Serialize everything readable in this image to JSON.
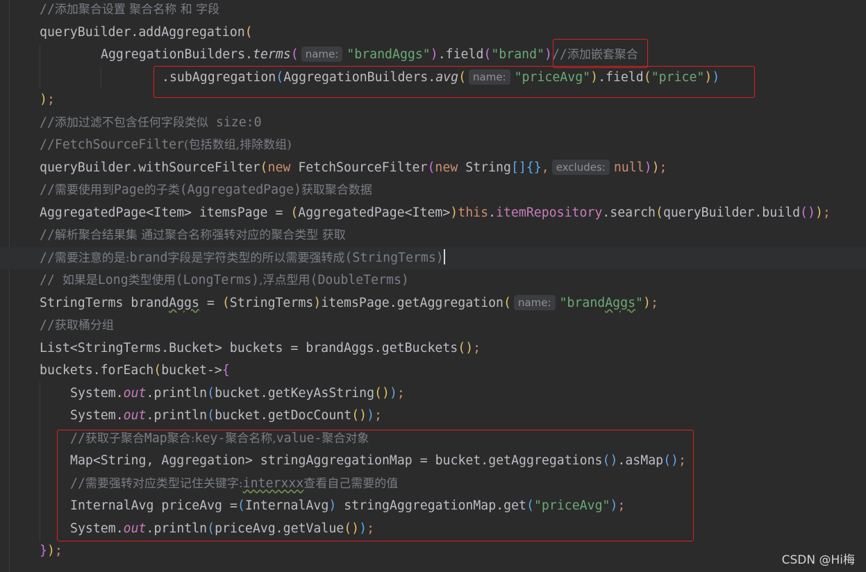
{
  "lines": [
    {
      "indent": 57,
      "segs": [
        {
          "t": "//",
          "c": "cm"
        },
        {
          "t": "添加聚合设置 聚合名称 和 字段",
          "c": "cmz"
        }
      ]
    },
    {
      "indent": 57,
      "segs": [
        {
          "t": "queryBuilder.addAggregation"
        },
        {
          "t": "(",
          "c": "p1"
        }
      ]
    },
    {
      "indent": 145,
      "segs": [
        {
          "t": "AggregationBuilders."
        },
        {
          "t": "terms",
          "c": "itm"
        },
        {
          "t": "(",
          "c": "p2"
        },
        {
          "h": "name:"
        },
        {
          "t": "\"brandAggs\"",
          "c": "str"
        },
        {
          "t": ")",
          "c": "p2"
        },
        {
          "t": ".field"
        },
        {
          "t": "(",
          "c": "p2"
        },
        {
          "t": "\"brand\"",
          "c": "str"
        },
        {
          "t": ")",
          "c": "p2"
        },
        {
          "t": "//",
          "c": "cm"
        },
        {
          "t": "添加嵌套聚合",
          "c": "cmz"
        }
      ]
    },
    {
      "indent": 233,
      "segs": [
        {
          "t": ".subAggregation"
        },
        {
          "t": "(",
          "c": "p3"
        },
        {
          "t": "AggregationBuilders."
        },
        {
          "t": "avg",
          "c": "itm"
        },
        {
          "t": "(",
          "c": "p1"
        },
        {
          "h": "name:"
        },
        {
          "t": "\"priceAvg\"",
          "c": "str"
        },
        {
          "t": ")",
          "c": "p1"
        },
        {
          "t": ".field"
        },
        {
          "t": "(",
          "c": "p1"
        },
        {
          "t": "\"price\"",
          "c": "str"
        },
        {
          "t": ")",
          "c": "p1"
        },
        {
          "t": ")",
          "c": "p3"
        }
      ]
    },
    {
      "indent": 57,
      "segs": [
        {
          "t": ")",
          "c": "p1"
        },
        {
          "t": ";",
          "c": "kw"
        }
      ]
    },
    {
      "indent": 57,
      "segs": [
        {
          "t": "//",
          "c": "cm"
        },
        {
          "t": "添加过滤不包含任何字段类似",
          "c": "cmz"
        },
        {
          "t": " size:0",
          "c": "cm"
        }
      ]
    },
    {
      "indent": 57,
      "segs": [
        {
          "t": "//FetchSourceFilter",
          "c": "cm"
        },
        {
          "t": "(包括数组,排除数组)",
          "c": "cmz"
        }
      ]
    },
    {
      "indent": 57,
      "segs": [
        {
          "t": "queryBuilder.withSourceFilter"
        },
        {
          "t": "(",
          "c": "p1"
        },
        {
          "t": "new ",
          "c": "kw"
        },
        {
          "t": "FetchSourceFilter"
        },
        {
          "t": "(",
          "c": "p2"
        },
        {
          "t": "new ",
          "c": "kw"
        },
        {
          "t": "String"
        },
        {
          "t": "[]{}",
          "c": "p3"
        },
        {
          "t": ",",
          "c": "kw"
        },
        {
          "h": "excludes:"
        },
        {
          "t": "null",
          "c": "kw"
        },
        {
          "t": ")",
          "c": "p2"
        },
        {
          "t": ")",
          "c": "p1"
        },
        {
          "t": ";",
          "c": "kw"
        }
      ]
    },
    {
      "indent": 57,
      "segs": [
        {
          "t": "//",
          "c": "cm"
        },
        {
          "t": "需要使用到",
          "c": "cmz"
        },
        {
          "t": "Page",
          "c": "cm"
        },
        {
          "t": "的子类",
          "c": "cmz"
        },
        {
          "t": "(AggregatedPage)",
          "c": "cm"
        },
        {
          "t": "获取聚合数据",
          "c": "cmz"
        }
      ]
    },
    {
      "indent": 57,
      "segs": [
        {
          "t": "AggregatedPage<Item> itemsPage = "
        },
        {
          "t": "(",
          "c": "p1"
        },
        {
          "t": "AggregatedPage<Item>"
        },
        {
          "t": ")",
          "c": "p1"
        },
        {
          "t": "this",
          "c": "kw"
        },
        {
          "t": "."
        },
        {
          "t": "itemRepository",
          "c": "fld"
        },
        {
          "t": ".search"
        },
        {
          "t": "(",
          "c": "p1"
        },
        {
          "t": "queryBuilder.build"
        },
        {
          "t": "()",
          "c": "p2"
        },
        {
          "t": ")",
          "c": "p1"
        },
        {
          "t": ";",
          "c": "kw"
        }
      ]
    },
    {
      "indent": 57,
      "segs": [
        {
          "t": "//",
          "c": "cm"
        },
        {
          "t": "解析聚合结果集 通过聚合名称强转对应的聚合类型 获取",
          "c": "cmz"
        }
      ]
    },
    {
      "indent": 57,
      "current": true,
      "segs": [
        {
          "t": "//",
          "c": "cm"
        },
        {
          "t": "需要注意的是:",
          "c": "cmz"
        },
        {
          "t": "brand",
          "c": "cm"
        },
        {
          "t": "字段是字符类型的所以需要强转成",
          "c": "cmz"
        },
        {
          "t": "(StringTerms)",
          "c": "cm"
        },
        {
          "caret": true
        }
      ]
    },
    {
      "indent": 57,
      "segs": [
        {
          "t": "// ",
          "c": "cm"
        },
        {
          "t": "如果是",
          "c": "cmz"
        },
        {
          "t": "Long",
          "c": "cm"
        },
        {
          "t": "类型使用",
          "c": "cmz"
        },
        {
          "t": "(LongTerms)",
          "c": "cm"
        },
        {
          "t": ",浮点型用",
          "c": "cmz"
        },
        {
          "t": "(DoubleTerms)",
          "c": "cm"
        }
      ]
    },
    {
      "indent": 57,
      "segs": [
        {
          "t": "StringTerms brand"
        },
        {
          "t": "Aggs",
          "c": "squig"
        },
        {
          "t": " = "
        },
        {
          "t": "(",
          "c": "p1"
        },
        {
          "t": "StringTerms"
        },
        {
          "t": ")",
          "c": "p1"
        },
        {
          "t": "itemsPage.getAggregation"
        },
        {
          "t": "(",
          "c": "p1"
        },
        {
          "h": "name:"
        },
        {
          "t": "\"brand",
          "c": "str"
        },
        {
          "t": "Aggs",
          "c": "str squig"
        },
        {
          "t": "\"",
          "c": "str"
        },
        {
          "t": ")",
          "c": "p1"
        },
        {
          "t": ";",
          "c": "kw"
        }
      ]
    },
    {
      "indent": 57,
      "segs": [
        {
          "t": "//",
          "c": "cm"
        },
        {
          "t": "获取桶分组",
          "c": "cmz"
        }
      ]
    },
    {
      "indent": 57,
      "segs": [
        {
          "t": "List<StringTerms.Bucket> buckets = brandAggs.getBuckets"
        },
        {
          "t": "()",
          "c": "p1"
        },
        {
          "t": ";",
          "c": "kw"
        }
      ]
    },
    {
      "indent": 57,
      "segs": [
        {
          "t": "buckets.forEach"
        },
        {
          "t": "(",
          "c": "p1"
        },
        {
          "t": "bucket->"
        },
        {
          "t": "{",
          "c": "p2"
        }
      ]
    },
    {
      "indent": 101,
      "segs": [
        {
          "t": "System."
        },
        {
          "t": "out",
          "c": "it"
        },
        {
          "t": ".println"
        },
        {
          "t": "(",
          "c": "p3"
        },
        {
          "t": "bucket.getKeyAsString"
        },
        {
          "t": "()",
          "c": "p1"
        },
        {
          "t": ")",
          "c": "p3"
        },
        {
          "t": ";",
          "c": "kw"
        }
      ]
    },
    {
      "indent": 101,
      "segs": [
        {
          "t": "System."
        },
        {
          "t": "out",
          "c": "it"
        },
        {
          "t": ".println"
        },
        {
          "t": "(",
          "c": "p3"
        },
        {
          "t": "bucket.getDocCount"
        },
        {
          "t": "()",
          "c": "p1"
        },
        {
          "t": ")",
          "c": "p3"
        },
        {
          "t": ";",
          "c": "kw"
        }
      ]
    },
    {
      "indent": 101,
      "segs": [
        {
          "t": "//",
          "c": "cm"
        },
        {
          "t": "获取子聚合",
          "c": "cmz"
        },
        {
          "t": "Map",
          "c": "cm"
        },
        {
          "t": "聚合:",
          "c": "cmz"
        },
        {
          "t": "key-",
          "c": "cm"
        },
        {
          "t": "聚合名称,",
          "c": "cmz"
        },
        {
          "t": "value-",
          "c": "cm"
        },
        {
          "t": "聚合对象",
          "c": "cmz"
        }
      ]
    },
    {
      "indent": 101,
      "segs": [
        {
          "t": "Map<String, Aggregation> stringAggregationMap = bucket.getAggregations"
        },
        {
          "t": "()",
          "c": "p3"
        },
        {
          "t": ".asMap"
        },
        {
          "t": "()",
          "c": "p3"
        },
        {
          "t": ";",
          "c": "kw"
        }
      ]
    },
    {
      "indent": 101,
      "segs": [
        {
          "t": "//",
          "c": "cm"
        },
        {
          "t": "需要强转对应类型记住关键字:",
          "c": "cmz"
        },
        {
          "t": "interxxx",
          "c": "cm squig"
        },
        {
          "t": "查看自己需要的值",
          "c": "cmz"
        }
      ]
    },
    {
      "indent": 101,
      "segs": [
        {
          "t": "InternalAvg priceAvg ="
        },
        {
          "t": "(",
          "c": "p3"
        },
        {
          "t": "InternalAvg"
        },
        {
          "t": ")",
          "c": "p3"
        },
        {
          "t": " stringAggregationMap.get"
        },
        {
          "t": "(",
          "c": "p3"
        },
        {
          "t": "\"priceAvg\"",
          "c": "str"
        },
        {
          "t": ")",
          "c": "p3"
        },
        {
          "t": ";",
          "c": "kw"
        }
      ]
    },
    {
      "indent": 101,
      "segs": [
        {
          "t": "System."
        },
        {
          "t": "out",
          "c": "it"
        },
        {
          "t": ".println"
        },
        {
          "t": "(",
          "c": "p3"
        },
        {
          "t": "priceAvg.getValue"
        },
        {
          "t": "()",
          "c": "p1"
        },
        {
          "t": ")",
          "c": "p3"
        },
        {
          "t": ";",
          "c": "kw"
        }
      ]
    },
    {
      "indent": 57,
      "segs": [
        {
          "t": "}",
          "c": "p2"
        },
        {
          "t": ")",
          "c": "p1"
        },
        {
          "t": ";",
          "c": "kw"
        }
      ]
    }
  ],
  "watermark": "CSDN @Hi梅"
}
